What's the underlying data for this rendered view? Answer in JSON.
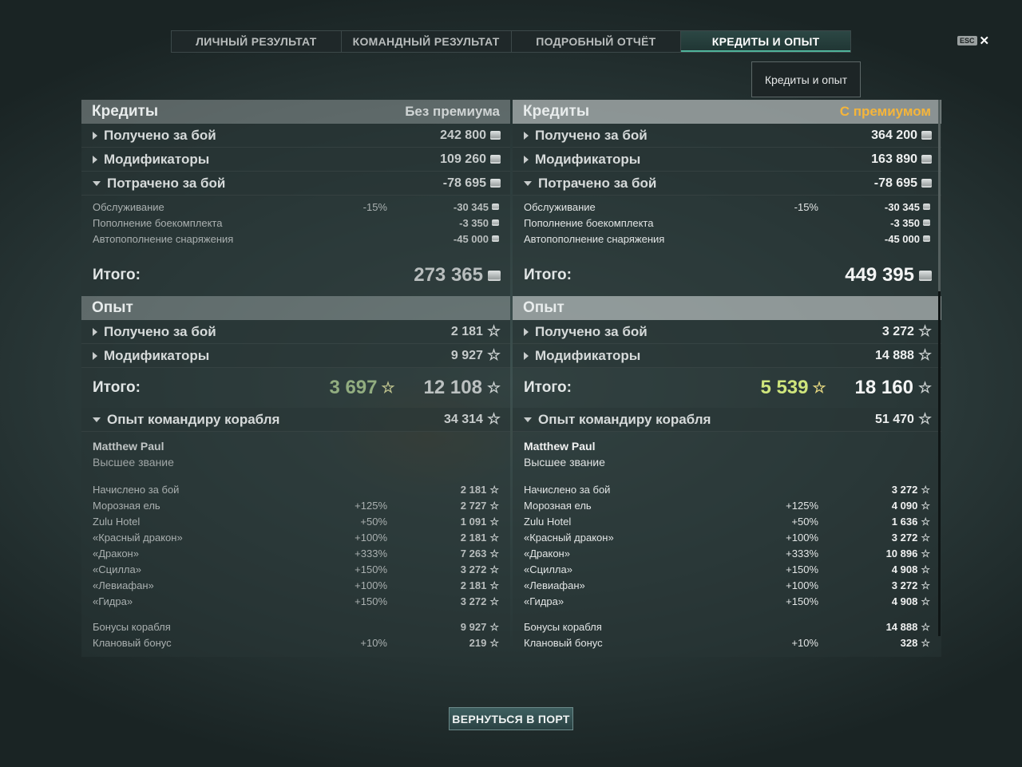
{
  "tabs": [
    "ЛИЧНЫЙ РЕЗУЛЬТАТ",
    "КОМАНДНЫЙ РЕЗУЛЬТАТ",
    "ПОДРОБНЫЙ ОТЧЁТ",
    "КРЕДИТЫ И ОПЫТ"
  ],
  "active_tab": 3,
  "esc_label": "ESC",
  "close_glyph": "✕",
  "tooltip": "Кредиты и опыт",
  "return_button": "ВЕРНУТЬСЯ В ПОРТ",
  "colors": {
    "premium": "#f5b53a",
    "xp_green_left": "#92ad80",
    "xp_green_right": "#cfe57c",
    "active_tab_accent": "#4fb39a"
  },
  "icons": {
    "coin": "credits-coin-icon",
    "star": "xp-star-icon",
    "expand": "triangle-right-icon",
    "collapse": "triangle-down-icon"
  },
  "left": {
    "credits_title": "Кредиты",
    "credits_mode": "Без премиума",
    "earned_label": "Получено за бой",
    "earned": "242 800",
    "modifiers_label": "Модификаторы",
    "modifiers": "109 260",
    "spent_label": "Потрачено за бой",
    "spent": "-78 695",
    "service_label": "Обслуживание",
    "service_pct": "-15%",
    "service": "-30 345",
    "ammo_label": "Пополнение боекомплекта",
    "ammo": "-3 350",
    "supply_label": "Автопополнение снаряжения",
    "supply": "-45 000",
    "total_label": "Итого:",
    "total": "273 365",
    "xp_title": "Опыт",
    "xp_earned_label": "Получено за бой",
    "xp_earned": "2 181",
    "xp_mod_label": "Модификаторы",
    "xp_mod": "9 927",
    "xp_total_label": "Итого:",
    "xp_total_ship": "3 697",
    "xp_total": "12 108",
    "cmd_label": "Опыт командиру корабля",
    "cmd_xp": "34 314",
    "cmd_name": "Matthew Paul",
    "cmd_rank": "Высшее звание",
    "lines": [
      {
        "name": "Начислено за бой",
        "pct": "",
        "val": "2 181"
      },
      {
        "name": "Морозная ель",
        "pct": "+125%",
        "val": "2 727"
      },
      {
        "name": "Zulu Hotel",
        "pct": "+50%",
        "val": "1 091"
      },
      {
        "name": "«Красный дракон»",
        "pct": "+100%",
        "val": "2 181"
      },
      {
        "name": "«Дракон»",
        "pct": "+333%",
        "val": "7 263"
      },
      {
        "name": "«Сцилла»",
        "pct": "+150%",
        "val": "3 272"
      },
      {
        "name": "«Левиафан»",
        "pct": "+100%",
        "val": "2 181"
      },
      {
        "name": "«Гидра»",
        "pct": "+150%",
        "val": "3 272"
      }
    ],
    "bonus_label": "Бонусы корабля",
    "bonus": "9 927",
    "clan_label": "Клановый бонус",
    "clan_pct": "+10%",
    "clan": "219"
  },
  "right": {
    "credits_title": "Кредиты",
    "credits_mode": "С премиумом",
    "earned_label": "Получено за бой",
    "earned": "364 200",
    "modifiers_label": "Модификаторы",
    "modifiers": "163 890",
    "spent_label": "Потрачено за бой",
    "spent": "-78 695",
    "service_label": "Обслуживание",
    "service_pct": "-15%",
    "service": "-30 345",
    "ammo_label": "Пополнение боекомплекта",
    "ammo": "-3 350",
    "supply_label": "Автопополнение снаряжения",
    "supply": "-45 000",
    "total_label": "Итого:",
    "total": "449 395",
    "xp_title": "Опыт",
    "xp_earned_label": "Получено за бой",
    "xp_earned": "3 272",
    "xp_mod_label": "Модификаторы",
    "xp_mod": "14 888",
    "xp_total_label": "Итого:",
    "xp_total_ship": "5 539",
    "xp_total": "18 160",
    "cmd_label": "Опыт командиру корабля",
    "cmd_xp": "51 470",
    "cmd_name": "Matthew Paul",
    "cmd_rank": "Высшее звание",
    "lines": [
      {
        "name": "Начислено за бой",
        "pct": "",
        "val": "3 272"
      },
      {
        "name": "Морозная ель",
        "pct": "+125%",
        "val": "4 090"
      },
      {
        "name": "Zulu Hotel",
        "pct": "+50%",
        "val": "1 636"
      },
      {
        "name": "«Красный дракон»",
        "pct": "+100%",
        "val": "3 272"
      },
      {
        "name": "«Дракон»",
        "pct": "+333%",
        "val": "10 896"
      },
      {
        "name": "«Сцилла»",
        "pct": "+150%",
        "val": "4 908"
      },
      {
        "name": "«Левиафан»",
        "pct": "+100%",
        "val": "3 272"
      },
      {
        "name": "«Гидра»",
        "pct": "+150%",
        "val": "4 908"
      }
    ],
    "bonus_label": "Бонусы корабля",
    "bonus": "14 888",
    "clan_label": "Клановый бонус",
    "clan_pct": "+10%",
    "clan": "328"
  }
}
